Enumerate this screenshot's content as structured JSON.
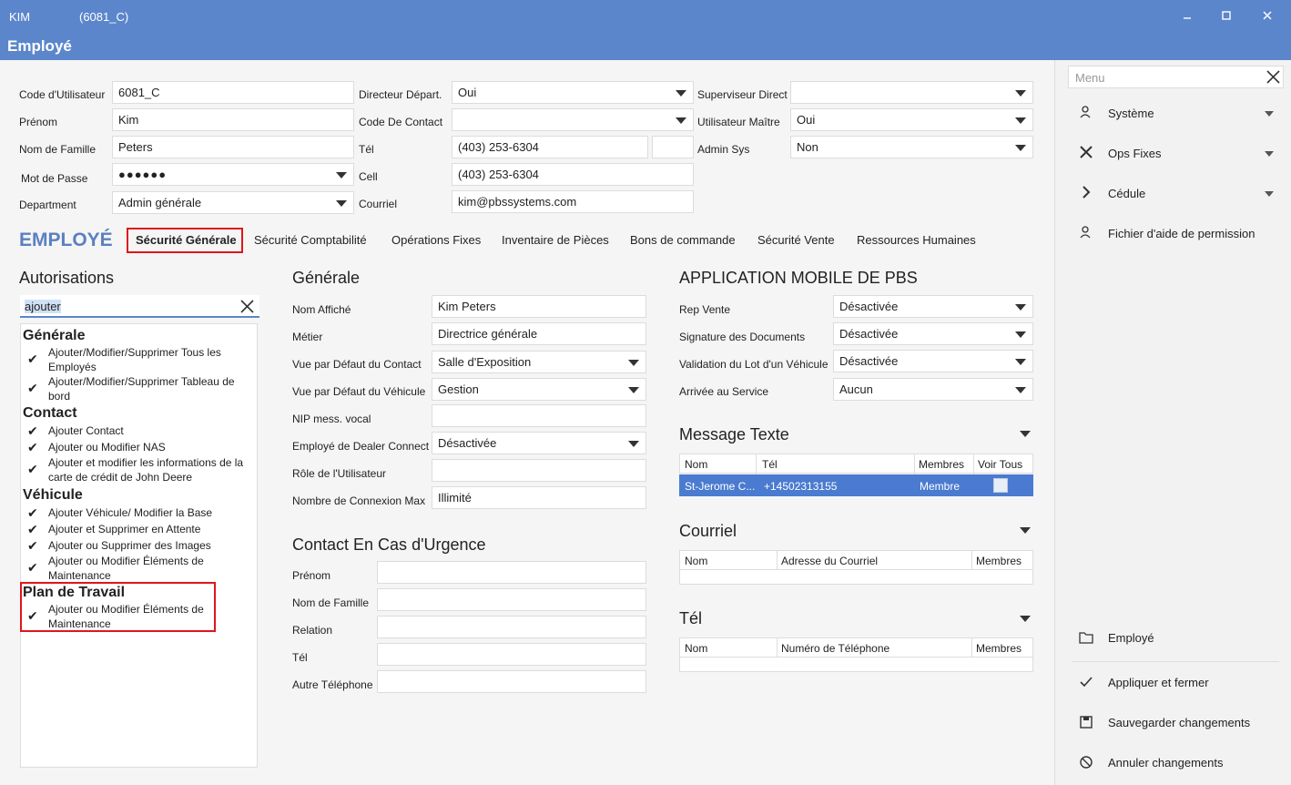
{
  "titlebar": {
    "user": "KIM",
    "code": "(6081_C)",
    "subtitle": "Employé"
  },
  "form": {
    "code_label": "Code d'Utilisateur",
    "code_value": "6081_C",
    "prenom_label": "Prénom",
    "prenom_value": "Kim",
    "nom_label": "Nom de Famille",
    "nom_value": "Peters",
    "passe_label": "Mot de Passe",
    "passe_value": "●●●●●●",
    "dept_label": "Department",
    "dept_value": "Admin générale",
    "directeur_label": "Directeur Départ.",
    "directeur_value": "Oui",
    "contact_label": "Code De Contact",
    "contact_value": "",
    "tel_label": "Tél",
    "tel_value": "(403) 253-6304",
    "tel_ext": "",
    "cell_label": "Cell",
    "cell_value": "(403) 253-6304",
    "courriel_label": "Courriel",
    "courriel_value": "kim@pbssystems.com",
    "superviseur_label": "Superviseur Direct",
    "superviseur_value": "",
    "maitre_label": "Utilisateur Maître",
    "maitre_value": "Oui",
    "adminsys_label": "Admin Sys",
    "adminsys_value": "Non"
  },
  "tabs": {
    "heading": "EMPLOYÉ",
    "items": [
      "Sécurité Générale",
      "Sécurité Comptabilité",
      "Opérations Fixes",
      "Inventaire de Pièces",
      "Bons de commande",
      "Sécurité Vente",
      "Ressources Humaines"
    ]
  },
  "autorisations": {
    "title": "Autorisations",
    "search_value": "ajouter",
    "groups": {
      "generale": "Générale",
      "contact": "Contact",
      "vehicule": "Véhicule",
      "plan": "Plan de Travail"
    },
    "items": {
      "g1": "Ajouter/Modifier/Supprimer Tous les Employés",
      "g2": "Ajouter/Modifier/Supprimer Tableau de bord",
      "c1": "Ajouter Contact",
      "c2": "Ajouter ou Modifier NAS",
      "c3": "Ajouter et modifier les informations de la carte de crédit de John Deere",
      "v1": "Ajouter Véhicule/ Modifier la Base",
      "v2": "Ajouter et Supprimer en Attente",
      "v3": "Ajouter ou Supprimer des Images",
      "v4": "Ajouter ou Modifier Éléments de Maintenance",
      "p1": "Ajouter ou Modifier Éléments de Maintenance"
    }
  },
  "generale": {
    "title": "Générale",
    "nom_affiche_label": "Nom Affiché",
    "nom_affiche_value": "Kim Peters",
    "metier_label": "Métier",
    "metier_value": "Directrice générale",
    "vue_contact_label": "Vue par Défaut du Contact",
    "vue_contact_value": "Salle d'Exposition",
    "vue_vehicule_label": "Vue par Défaut du Véhicule",
    "vue_vehicule_value": "Gestion",
    "nip_label": "NIP mess. vocal",
    "nip_value": "",
    "dealer_label": "Employé de Dealer Connect",
    "dealer_value": "Désactivée",
    "role_label": "Rôle de l'Utilisateur",
    "role_value": "",
    "connexion_label": "Nombre de Connexion Max",
    "connexion_value": "Illimité"
  },
  "urgence": {
    "title": "Contact En Cas d'Urgence",
    "prenom": "Prénom",
    "nom": "Nom de Famille",
    "relation": "Relation",
    "tel": "Tél",
    "autre": "Autre Téléphone"
  },
  "mobile": {
    "title": "APPLICATION MOBILE DE PBS",
    "rep_label": "Rep Vente",
    "rep_value": "Désactivée",
    "sig_label": "Signature des Documents",
    "sig_value": "Désactivée",
    "lot_label": "Validation du Lot d'un Véhicule",
    "lot_value": "Désactivée",
    "arrivee_label": "Arrivée au Service",
    "arrivee_value": "Aucun"
  },
  "message": {
    "title": "Message Texte",
    "cols": [
      "Nom",
      "Tél",
      "Membres",
      "Voir Tous"
    ],
    "row": {
      "nom": "St-Jerome C...",
      "tel": "+14502313155",
      "membres": "Membre"
    }
  },
  "courriel": {
    "title": "Courriel",
    "cols": [
      "Nom",
      "Adresse du Courriel",
      "Membres"
    ]
  },
  "tel": {
    "title": "Tél",
    "cols": [
      "Nom",
      "Numéro de Téléphone",
      "Membres"
    ]
  },
  "sidebar": {
    "search_placeholder": "Menu",
    "items": [
      "Système",
      "Ops Fixes",
      "Cédule",
      "Fichier d'aide de permission"
    ],
    "bottom": [
      "Employé",
      "Appliquer et fermer",
      "Sauvegarder changements",
      "Annuler changements"
    ]
  },
  "colors": {
    "titlebar": "#5b86cc",
    "selected_row": "#4a7bd0",
    "highlight": "#e0151a",
    "heading_blue": "#5b80c0"
  }
}
